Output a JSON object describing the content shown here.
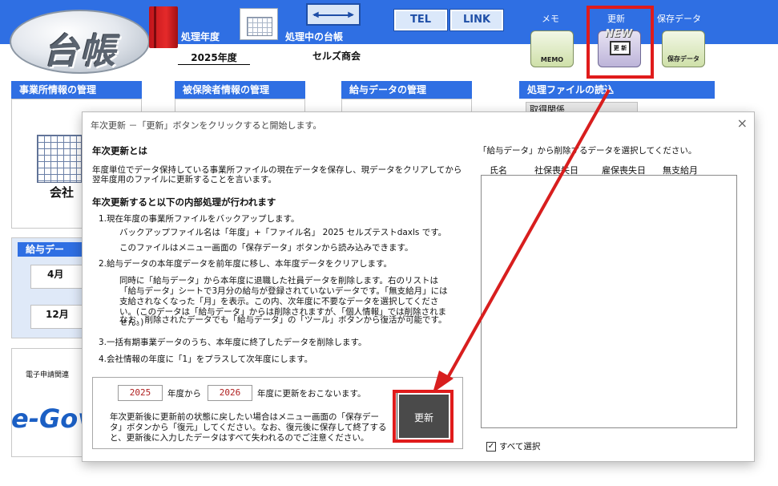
{
  "header": {
    "logo_text": "台帳",
    "fiscal_year_label": "処理年度",
    "fiscal_year_value": "2025年度",
    "ledger_label": "処理中の台帳",
    "ledger_value": "セルズ商会",
    "tel_label": "TEL",
    "link_label": "LINK",
    "memo_label": "メモ",
    "memo_caption": "MEMO",
    "update_label": "更新",
    "update_new": "NEW",
    "update_inner": "更 新",
    "save_label": "保存データ",
    "save_caption": "保存データ"
  },
  "sections": {
    "office": "事業所情報の管理",
    "insured": "被保険者情報の管理",
    "salary": "給与データの管理",
    "files": "処理ファイルの読込",
    "files_sub": "取得関係",
    "company_caption": "会社",
    "salary_data": "給与デー",
    "month_apr": "4月",
    "month_dec": "12月",
    "e_filing": "電子申請関連",
    "egov": "e-Gov"
  },
  "dialog": {
    "title": "年次更新 －「更新」ボタンをクリックすると開始します。",
    "what_heading": "年次更新とは",
    "what_line1": "年度単位でデータ保持している事業所ファイルの現在データを保存し、現データをクリアしてから",
    "what_line2": "翌年度用のファイルに更新することを言います。",
    "process_heading": "年次更新すると以下の内部処理が行われます",
    "step1": "1.現在年度の事業所ファイルをバックアップします。",
    "step1_detail1": "バックアップファイル名は「年度」+「ファイル名」 2025 セルズテストdaxls  です。",
    "step1_detail2": "このファイルはメニュー画面の「保存データ」ボタンから読み込みできます。",
    "step2": "2.給与データの本年度データを前年度に移し、本年度データをクリアします。",
    "step2_detail": "同時に「給与データ」から本年度に退職した社員データを削除します。右のリストは「給与データ」シートで3月分の給与が登録されていないデータです。「無支給月」には支給されなくなった「月」を表示。この内、次年度に不要なデータを選択してください。(このデータは「給与データ」からは削除されますが、「個人情報」では削除されません。)",
    "step2_detail2": "なお、削除されたデータでも「給与データ」の「ツール」ボタンから復活が可能です。",
    "step3": "3.一括有期事業データのうち、本年度に終了したデータを削除します。",
    "step4": "4.会社情報の年度に「1」をプラスして次年度にします。",
    "from_year": "2025",
    "from_suffix": "年度から",
    "to_year": "2026",
    "to_suffix": "年度に更新をおこないます。",
    "restore_note": "年次更新後に更新前の状態に戻したい場合はメニュー画面の「保存データ」ボタンから「復元」してください。なお、復元後に保存して終了すると、更新後に入力したデータはすべて失われるのでご注意ください。",
    "update_button": "更新",
    "list_instruction": "「給与データ」から削除するデータを選択してください。",
    "col_name": "氏名",
    "col_social": "社保喪失日",
    "col_employment": "雇保喪失日",
    "col_unpaid": "無支給月",
    "select_all": "すべて選択",
    "checkbox_mark": "✓",
    "close_icon": "×"
  },
  "colors": {
    "header_blue": "#2f6fe3",
    "highlight_red": "#e01b1b",
    "arrow_red": "#d81e1e"
  }
}
